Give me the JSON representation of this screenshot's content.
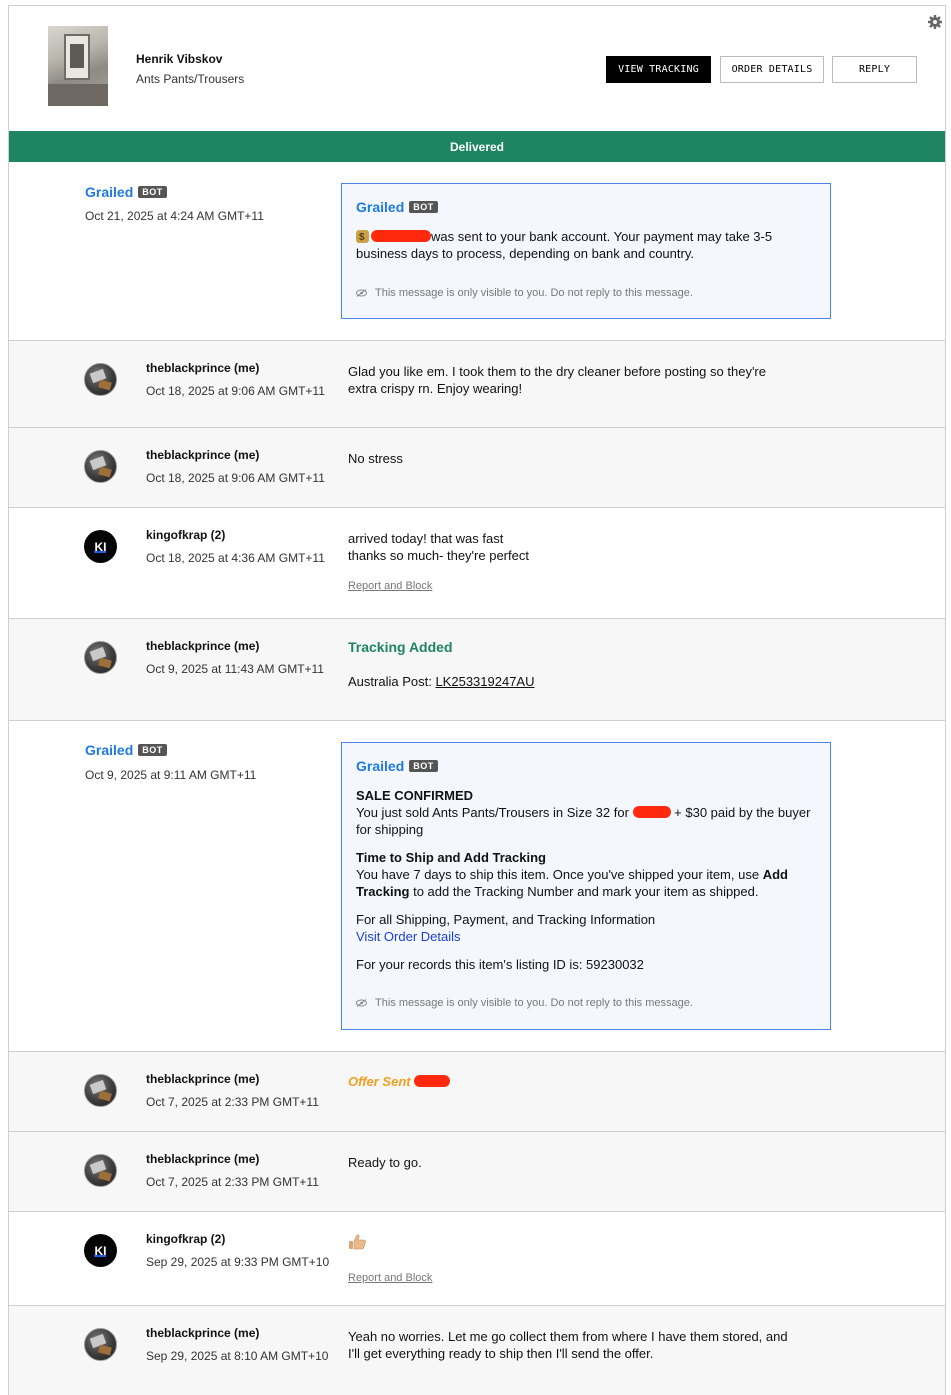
{
  "header": {
    "seller_name": "Henrik Vibskov",
    "item_name": "Ants Pants/Trousers",
    "buttons": {
      "view_tracking": "VIEW TRACKING",
      "order_details": "ORDER DETAILS",
      "reply": "REPLY"
    }
  },
  "status_banner": "Delivered",
  "messages": [
    {
      "sender": "Grailed",
      "badge": "BOT",
      "date": "Oct 21, 2025 at 4:24 AM GMT+11",
      "box_sender": "Grailed",
      "text": "was sent to your bank account. Your payment may take 3-5 business days to process, depending on bank and country.",
      "note": "This message is only visible to you. Do not reply to this message."
    },
    {
      "sender": "theblackprince (me)",
      "date": "Oct 18, 2025 at 9:06 AM GMT+11",
      "text": "Glad you like em. I took them to the dry cleaner before posting so they're extra crispy rn. Enjoy wearing!"
    },
    {
      "sender": "theblackprince (me)",
      "date": "Oct 18, 2025 at 9:06 AM GMT+11",
      "text": "No stress"
    },
    {
      "sender": "kingofkrap (2)",
      "avatar_initials": "KI",
      "date": "Oct 18, 2025 at 4:36 AM GMT+11",
      "text_line1": "arrived today! that was fast",
      "text_line2": "thanks so much- they're perfect",
      "report": "Report and Block"
    },
    {
      "sender": "theblackprince (me)",
      "date": "Oct 9, 2025 at 11:43 AM GMT+11",
      "title": "Tracking Added",
      "carrier": "Australia Post:",
      "tracking_number": "LK253319247AU"
    },
    {
      "sender": "Grailed",
      "badge": "BOT",
      "date": "Oct 9, 2025 at 9:11 AM GMT+11",
      "box_sender": "Grailed",
      "sale_title": "SALE CONFIRMED",
      "sale_text_a": "You just sold Ants Pants/Trousers in Size 32 for",
      "sale_text_b": "+ $30 paid by the buyer for shipping",
      "ship_title": "Time to Ship and Add Tracking",
      "ship_text_a": "You have 7 days to ship this item. Once you've shipped your item, use",
      "ship_bold": "Add Tracking",
      "ship_text_b": "to add the Tracking Number and mark your item as shipped.",
      "info_text": "For all Shipping, Payment, and Tracking Information",
      "info_link": "Visit Order Details",
      "records_text": "For your records this item's listing ID is: 59230032",
      "note": "This message is only visible to you. Do not reply to this message."
    },
    {
      "sender": "theblackprince (me)",
      "date": "Oct 7, 2025 at 2:33 PM GMT+11",
      "offer": "Offer Sent"
    },
    {
      "sender": "theblackprince (me)",
      "date": "Oct 7, 2025 at 2:33 PM GMT+11",
      "text": "Ready to go."
    },
    {
      "sender": "kingofkrap (2)",
      "avatar_initials": "KI",
      "date": "Sep 29, 2025 at 9:33 PM GMT+10",
      "emoji": "thumbs-up-icon",
      "report": "Report and Block"
    },
    {
      "sender": "theblackprince (me)",
      "date": "Sep 29, 2025 at 8:10 AM GMT+10",
      "text": "Yeah no worries. Let me go collect them from where I have them stored, and I'll get everything ready to ship then I'll send the offer."
    }
  ],
  "colors": {
    "delivered_green": "#1e8462",
    "grailed_blue": "#1f7ae0",
    "offer_orange": "#f0a020",
    "link_blue": "#1d3fd0"
  }
}
